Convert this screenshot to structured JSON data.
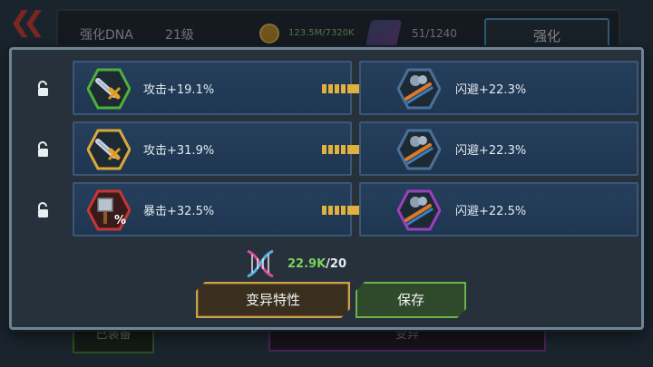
{
  "background": {
    "title": "强化DNA",
    "level": "21级",
    "coins": "123.5M/7320K",
    "dna_stock": "51/1240",
    "strengthen_button": "强化",
    "bottom_green_label": "已装备",
    "bottom_purple_label": "变异"
  },
  "rows": [
    {
      "left_stat": "攻击+19.1%",
      "left_icon": "sword-icon",
      "left_frame_color": "#4fae3a",
      "right_stat": "闪避+22.3%",
      "right_icon": "dodge-icon",
      "right_frame_color": "#4a6f9a"
    },
    {
      "left_stat": "攻击+31.9%",
      "left_icon": "sword-icon",
      "left_frame_color": "#d9a83a",
      "right_stat": "闪避+22.3%",
      "right_icon": "dodge-icon",
      "right_frame_color": "#4a6f9a"
    },
    {
      "left_stat": "暴击+32.5%",
      "left_icon": "crit-hammer-icon",
      "left_frame_color": "#c73636",
      "right_stat": "闪避+22.5%",
      "right_icon": "dodge-icon",
      "right_frame_color": "#9a3fc0"
    }
  ],
  "dna_counter": {
    "have": "22.9K",
    "separator": "/",
    "need": "20"
  },
  "buttons": {
    "mutate": "变异特性",
    "save": "保存"
  },
  "colors": {
    "accent_gold": "#caa24a",
    "accent_green": "#6fb24a",
    "arrow_gold": "#e0b13e"
  }
}
